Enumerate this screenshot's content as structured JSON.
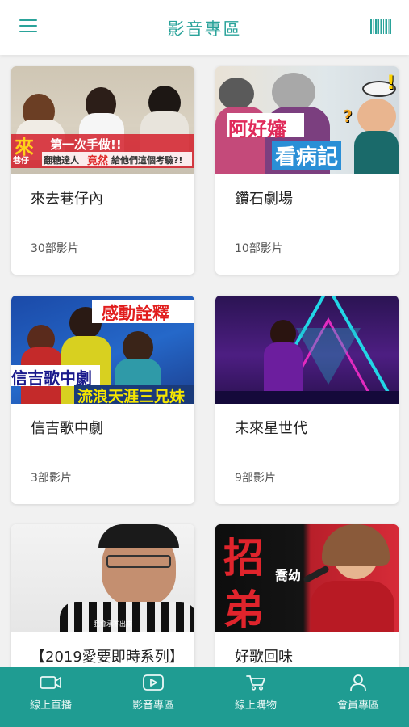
{
  "header": {
    "title": "影音專區",
    "menu_icon": "hamburger-menu-icon",
    "right_icon": "barcode-icon"
  },
  "colors": {
    "accent": "#2aa39a",
    "bottom_bar": "#1f9c92"
  },
  "cards": [
    {
      "title": "來去巷仔內",
      "count": "30部影片",
      "overlay": [
        "來",
        "巷仔",
        "第一次手做!!",
        "翻糖達人",
        "竟然",
        "給他們這個考驗?!"
      ]
    },
    {
      "title": "鑽石劇場",
      "count": "10部影片",
      "overlay": [
        "阿好嬸",
        "看病記",
        "!",
        "?"
      ]
    },
    {
      "title": "信吉歌中劇",
      "count": "3部影片",
      "overlay": [
        "感動詮釋",
        "信吉歌中劇",
        "流浪天涯三兄妹"
      ]
    },
    {
      "title": "未來星世代",
      "count": "9部影片",
      "overlay": []
    },
    {
      "title": "【2019愛要即時系列】",
      "count": "",
      "overlay": [
        "我會承不出來"
      ]
    },
    {
      "title": "好歌回味",
      "count": "",
      "overlay": [
        "招",
        "弟",
        "喬幼"
      ]
    }
  ],
  "tabs": [
    {
      "label": "線上直播",
      "icon": "video-camera-icon"
    },
    {
      "label": "影音專區",
      "icon": "play-button-icon"
    },
    {
      "label": "線上購物",
      "icon": "shopping-cart-icon"
    },
    {
      "label": "會員專區",
      "icon": "user-icon"
    }
  ]
}
